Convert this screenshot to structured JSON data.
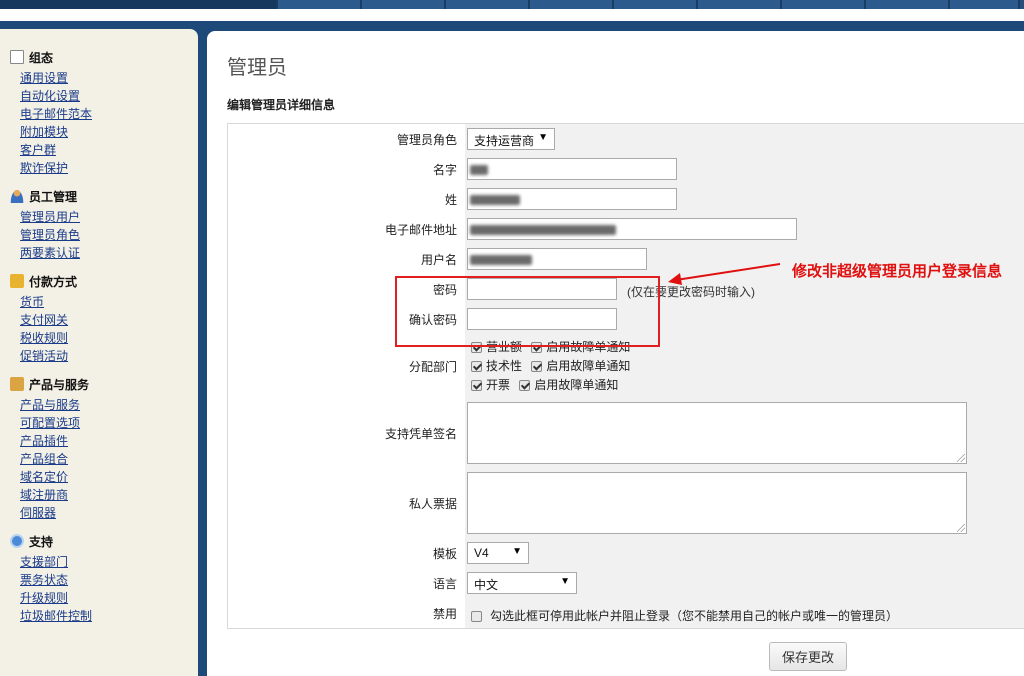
{
  "sidebar": {
    "sections": [
      {
        "title": "组态",
        "icon": "settings-doc-icon",
        "links": [
          "通用设置",
          "自动化设置",
          "电子邮件范本",
          "附加模块",
          "客户群",
          "欺诈保护"
        ]
      },
      {
        "title": "员工管理",
        "icon": "user-icon",
        "links": [
          "管理员用户",
          "管理员角色",
          "两要素认证"
        ]
      },
      {
        "title": "付款方式",
        "icon": "payment-icon",
        "links": [
          "货币",
          "支付网关",
          "税收规则",
          "促销活动"
        ]
      },
      {
        "title": "产品与服务",
        "icon": "box-icon",
        "links": [
          "产品与服务",
          "可配置选项",
          "产品插件",
          "产品组合",
          "域名定价",
          "域注册商",
          "伺服器"
        ]
      },
      {
        "title": "支持",
        "icon": "support-icon",
        "links": [
          "支援部门",
          "票务状态",
          "升级规则",
          "垃圾邮件控制"
        ]
      }
    ]
  },
  "main": {
    "title": "管理员",
    "subtitle": "编辑管理员详细信息",
    "fields": {
      "role_label": "管理员角色",
      "role_value": "支持运营商",
      "firstname_label": "名字",
      "lastname_label": "姓",
      "email_label": "电子邮件地址",
      "username_label": "用户名",
      "password_label": "密码",
      "password_hint": "(仅在要更改密码时输入)",
      "confirm_label": "确认密码",
      "departments_label": "分配部门",
      "signature_label": "支持凭单签名",
      "notes_label": "私人票据",
      "template_label": "模板",
      "template_value": "V4",
      "language_label": "语言",
      "language_value": "中文",
      "disable_label": "禁用",
      "disable_text": "勾选此框可停用此帐户并阻止登录（您不能禁用自己的帐户或唯一的管理员）"
    },
    "departments": [
      {
        "name": "营业额",
        "notify": "启用故障单通知"
      },
      {
        "name": "技术性",
        "notify": "启用故障单通知"
      },
      {
        "name": "开票",
        "notify": "启用故障单通知"
      }
    ],
    "save_label": "保存更改"
  },
  "annotation": {
    "text": "修改非超级管理员用户登录信息",
    "color": "#e01010"
  }
}
